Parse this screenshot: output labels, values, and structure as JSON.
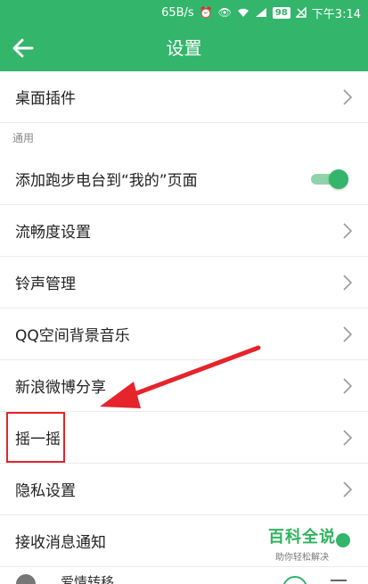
{
  "status": {
    "speed": "65B/s",
    "battery": "98",
    "time": "下午3:14"
  },
  "header": {
    "title": "设置"
  },
  "rows": [
    {
      "label": "桌面插件"
    },
    {
      "label": "添加跑步电台到“我的”页面"
    },
    {
      "label": "流畅度设置"
    },
    {
      "label": "铃声管理"
    },
    {
      "label": "QQ空间背景音乐"
    },
    {
      "label": "新浪微博分享"
    },
    {
      "label": "摇一摇"
    },
    {
      "label": "隐私设置"
    },
    {
      "label": "接收消息通知"
    }
  ],
  "section": {
    "general": "通用"
  },
  "toggle_run_station": {
    "on": true
  },
  "watermark": {
    "title": "百科全说",
    "subtitle": "助你轻松解决"
  },
  "mini_player": {
    "song": "爱情转移"
  },
  "colors": {
    "primary": "#33b56b",
    "annotation": "#e5242b"
  }
}
